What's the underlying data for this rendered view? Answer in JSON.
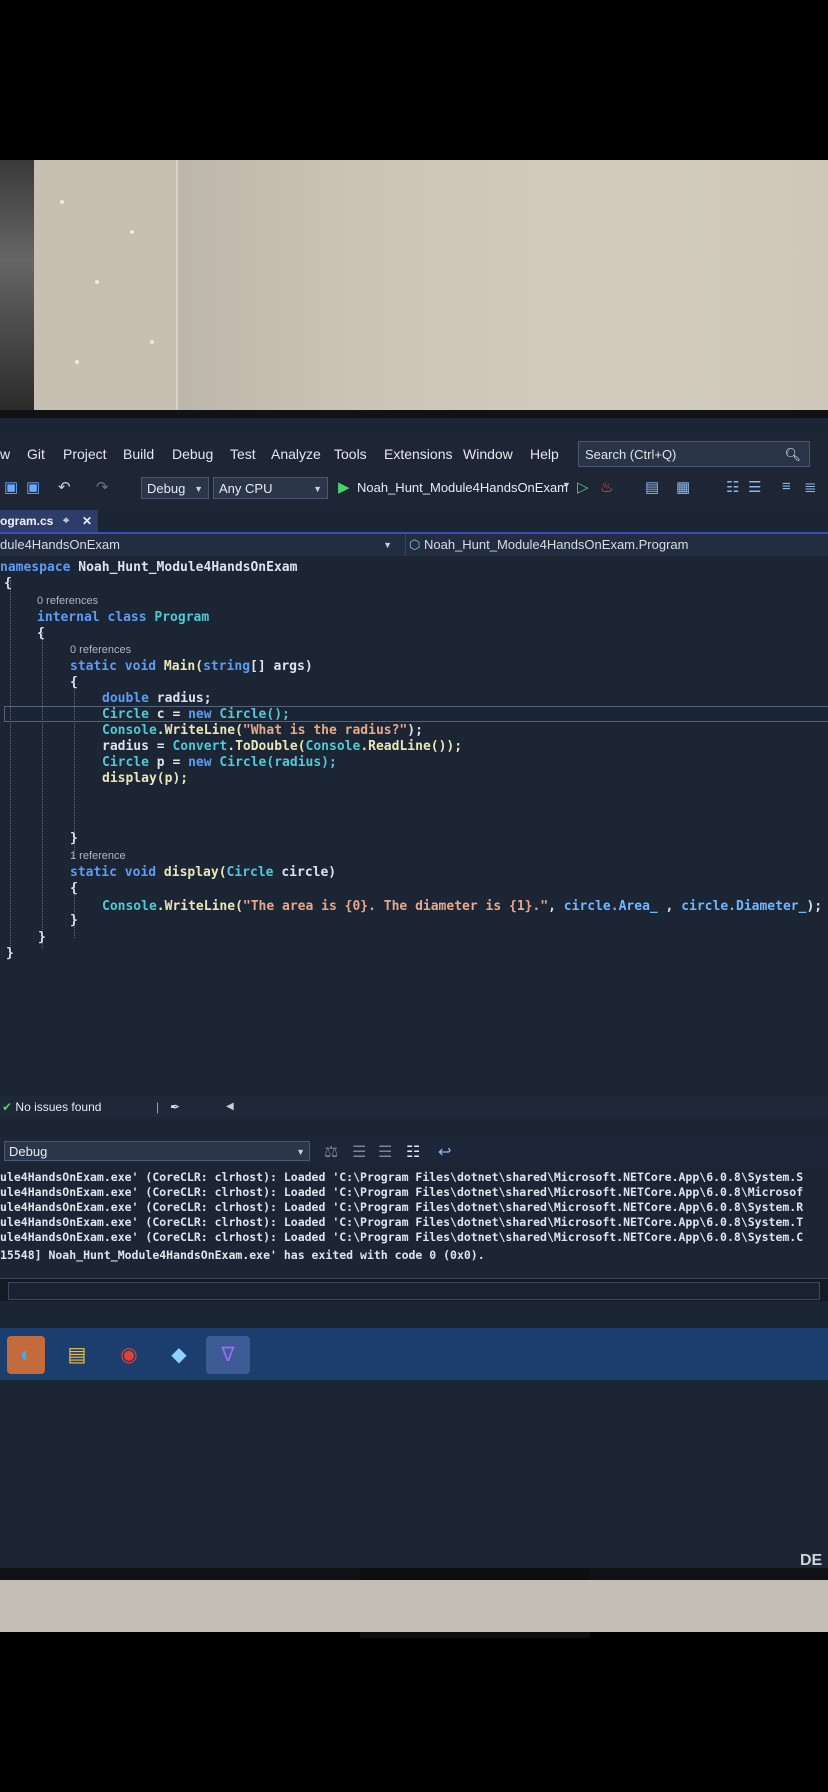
{
  "menu": {
    "items": [
      "w",
      "Git",
      "Project",
      "Build",
      "Debug",
      "Test",
      "Analyze",
      "Tools",
      "Extensions",
      "Window",
      "Help"
    ],
    "search_placeholder": "Search (Ctrl+Q)"
  },
  "toolbar": {
    "config": "Debug",
    "platform": "Any CPU",
    "run_target": "Noah_Hunt_Module4HandsOnExam"
  },
  "tab": {
    "label": "ogram.cs"
  },
  "navbar": {
    "project": "dule4HandsOnExam",
    "class": "Noah_Hunt_Module4HandsOnExam.Program"
  },
  "code": {
    "namespace_kw": "namespace",
    "namespace_name": "Noah_Hunt_Module4HandsOnExam",
    "open0": "{",
    "refs_class": "0 references",
    "class_kw": "internal class",
    "class_name": "Program",
    "open1": "{",
    "refs_main": "0 references",
    "main_kw": "static void",
    "main_sig": "Main(",
    "main_arg_type": "string",
    "main_arg": "[] args)",
    "open2": "{",
    "line1_kw": "double",
    "line1_rest": "radius;",
    "line2_type": "Circle",
    "line2_mid": "c = ",
    "line2_kw": "new",
    "line2_ctor": "Circle();",
    "line3_type": "Console",
    "line3_call": ".WriteLine(",
    "line3_str": "\"What is the radius?\"",
    "line3_end": ");",
    "line4_a": "radius = ",
    "line4_type": "Convert",
    "line4_b": ".ToDouble(",
    "line4_type2": "Console",
    "line4_c": ".ReadLine());",
    "line5_type": "Circle",
    "line5_mid": "p = ",
    "line5_kw": "new",
    "line5_ctor": "Circle(radius);",
    "line6": "display(p);",
    "close2": "}",
    "refs_display": "1 reference",
    "display_kw": "static void",
    "display_name": "display(",
    "display_type": "Circle",
    "display_arg": "circle)",
    "open3": "{",
    "disp_type": "Console",
    "disp_call": ".WriteLine(",
    "disp_str": "\"The area is {0}. The diameter is {1}.\"",
    "disp_mid": ", ",
    "disp_area": "circle.Area_",
    "disp_sep": " , ",
    "disp_diam": "circle.Diameter_",
    "disp_end": ");",
    "close3": "}",
    "close1": "}",
    "close0": "}"
  },
  "status": {
    "issues": "No issues found"
  },
  "output": {
    "source": "Debug",
    "lines": [
      "ule4HandsOnExam.exe' (CoreCLR: clrhost): Loaded 'C:\\Program Files\\dotnet\\shared\\Microsoft.NETCore.App\\6.0.8\\System.S",
      "ule4HandsOnExam.exe' (CoreCLR: clrhost): Loaded 'C:\\Program Files\\dotnet\\shared\\Microsoft.NETCore.App\\6.0.8\\Microsof",
      "ule4HandsOnExam.exe' (CoreCLR: clrhost): Loaded 'C:\\Program Files\\dotnet\\shared\\Microsoft.NETCore.App\\6.0.8\\System.R",
      "ule4HandsOnExam.exe' (CoreCLR: clrhost): Loaded 'C:\\Program Files\\dotnet\\shared\\Microsoft.NETCore.App\\6.0.8\\System.T",
      "ule4HandsOnExam.exe' (CoreCLR: clrhost): Loaded 'C:\\Program Files\\dotnet\\shared\\Microsoft.NETCore.App\\6.0.8\\System.C",
      "15548] Noah_Hunt_Module4HandsOnExam.exe' has exited with code 0 (0x0)."
    ]
  },
  "taskbar": {
    "icons": [
      "edge-icon",
      "file-explorer-icon",
      "chrome-icon",
      "azure-data-studio-icon",
      "visual-studio-icon"
    ]
  },
  "monitor": {
    "brand": "DE"
  }
}
